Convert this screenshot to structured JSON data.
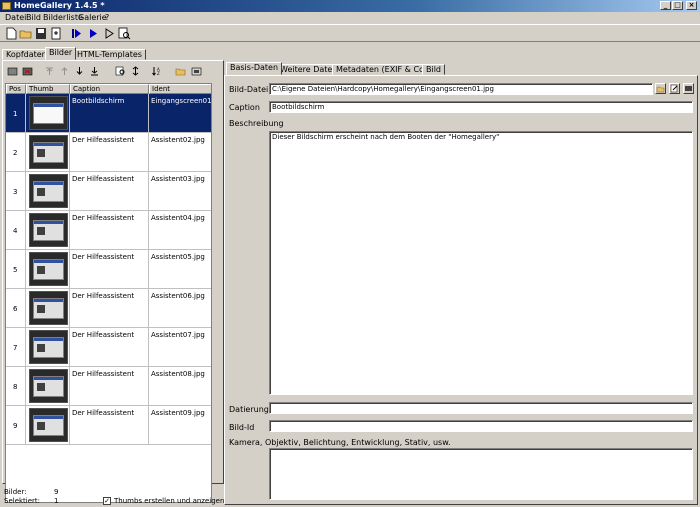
{
  "window": {
    "title": "HomeGallery 1.4.5 *"
  },
  "menu": [
    "Datei",
    "Bild",
    "Bilderliste",
    "Galerie",
    "?"
  ],
  "toolbar_icons": [
    "new-icon",
    "open-icon",
    "save-icon",
    "export-icon",
    "run-selected-icon",
    "run-icon",
    "play-icon",
    "preview-icon"
  ],
  "left_tabs": [
    "Kopfdaten",
    "Bilder",
    "HTML-Templates"
  ],
  "left_tab_active": "Bilder",
  "table": {
    "columns": [
      "Pos",
      "Thumb",
      "Caption",
      "Ident"
    ],
    "rows": [
      {
        "pos": "1",
        "caption": "Bootbildschirm",
        "ident": "Eingangscreen01",
        "selected": true
      },
      {
        "pos": "2",
        "caption": "Der Hilfeassistent",
        "ident": "Assistent02.jpg"
      },
      {
        "pos": "3",
        "caption": "Der Hilfeassistent",
        "ident": "Assistent03.jpg"
      },
      {
        "pos": "4",
        "caption": "Der Hilfeassistent",
        "ident": "Assistent04.jpg"
      },
      {
        "pos": "5",
        "caption": "Der Hilfeassistent",
        "ident": "Assistent05.jpg"
      },
      {
        "pos": "6",
        "caption": "Der Hilfeassistent",
        "ident": "Assistent06.jpg"
      },
      {
        "pos": "7",
        "caption": "Der Hilfeassistent",
        "ident": "Assistent07.jpg"
      },
      {
        "pos": "8",
        "caption": "Der Hilfeassistent",
        "ident": "Assistent08.jpg"
      },
      {
        "pos": "9",
        "caption": "Der Hilfeassistent",
        "ident": "Assistent09.jpg"
      }
    ]
  },
  "status": {
    "bilder_label": "Bilder:",
    "bilder_count": "9",
    "selektiert_label": "Selektiert:",
    "selektiert_count": "1",
    "thumbs_checkbox_label": "Thumbs erstellen und anzeigen",
    "thumbs_checked": true
  },
  "right_tabs": [
    "Basis-Daten",
    "Weitere Daten",
    "Metadaten (EXIF & Co.)",
    "Bild"
  ],
  "right_tab_active": "Basis-Daten",
  "form": {
    "bild_datei_label": "Bild-Datei",
    "bild_datei_value": "C:\\Eigene Dateien\\Hardcopy\\Homegallery\\Eingangscreen01.jpg",
    "caption_label": "Caption",
    "caption_value": "Bootbildschirm",
    "beschreibung_label": "Beschreibung",
    "beschreibung_value": "Dieser Bildschirm erscheint nach dem Booten der \"Homegallery\"",
    "datierung_label": "Datierung",
    "datierung_value": "",
    "bild_id_label": "Bild-Id",
    "bild_id_value": "",
    "kamera_label": "Kamera, Objektiv, Belichtung, Entwicklung, Stativ, usw.",
    "kamera_value": ""
  },
  "colors": {
    "selection": "#0a246a",
    "window_bg": "#d4d0c8",
    "titlebar": "#0a246a"
  }
}
